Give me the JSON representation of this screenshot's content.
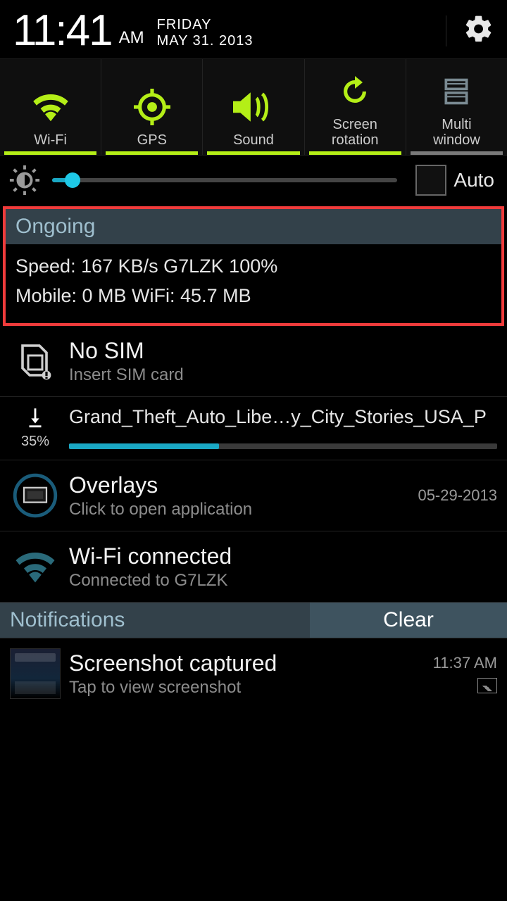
{
  "status": {
    "time": "11:41",
    "ampm": "AM",
    "day": "FRIDAY",
    "date": "MAY 31. 2013"
  },
  "toggles": {
    "wifi": "Wi-Fi",
    "gps": "GPS",
    "sound": "Sound",
    "rotation": "Screen\nrotation",
    "multiwindow": "Multi\nwindow"
  },
  "brightness": {
    "auto_label": "Auto",
    "auto_checked": false,
    "level_percent": 6
  },
  "ongoing": {
    "header": "Ongoing",
    "line1": "Speed: 167 KB/s   G7LZK 100%",
    "line2": "Mobile: 0 MB   WiFi: 45.7 MB"
  },
  "nosim": {
    "title": "No SIM",
    "sub": "Insert SIM card"
  },
  "download": {
    "filename": "Grand_Theft_Auto_Libe…y_City_Stories_USA_P",
    "percent": "35%",
    "progress": 35
  },
  "overlays": {
    "title": "Overlays",
    "sub": "Click to open application",
    "timestamp": "05-29-2013"
  },
  "wifi": {
    "title": "Wi-Fi connected",
    "sub": "Connected to G7LZK"
  },
  "notifications_header": "Notifications",
  "clear_label": "Clear",
  "screenshot": {
    "title": "Screenshot captured",
    "sub": "Tap to view screenshot",
    "time": "11:37 AM"
  }
}
